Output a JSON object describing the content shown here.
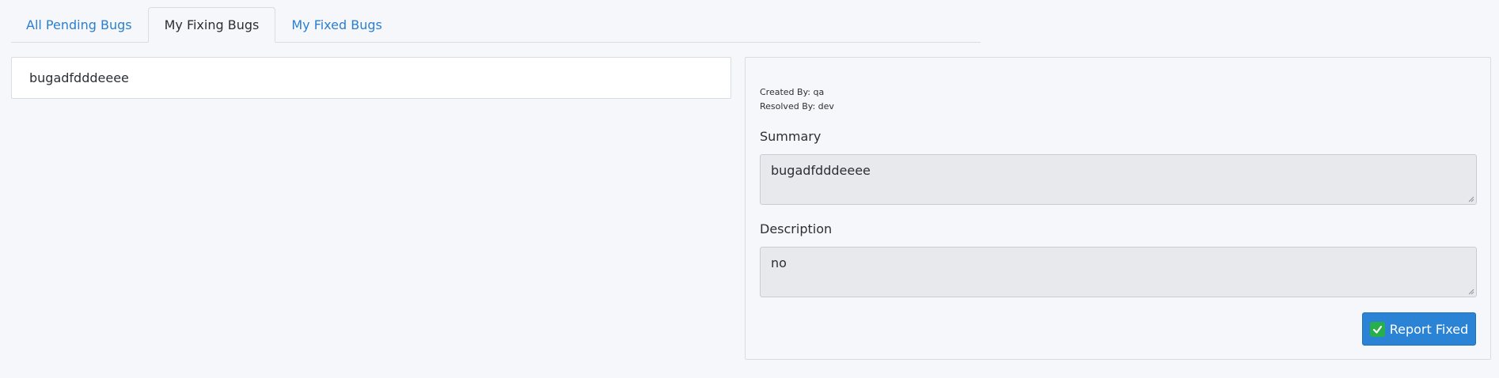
{
  "tabs": [
    {
      "label": "All Pending Bugs",
      "active": false
    },
    {
      "label": "My Fixing Bugs",
      "active": true
    },
    {
      "label": "My Fixed Bugs",
      "active": false
    }
  ],
  "bug_list": {
    "items": [
      {
        "title": "bugadfdddeeee"
      }
    ]
  },
  "detail": {
    "created_by": "Created By: qa",
    "resolved_by": "Resolved By: dev",
    "summary_label": "Summary",
    "summary_value": "bugadfdddeeee",
    "description_label": "Description",
    "description_value": "no",
    "report_button_label": "Report Fixed",
    "report_button_icon": "check-mark-icon"
  },
  "colors": {
    "accent": "#2b83d6",
    "tab_link": "#2a7fd0",
    "check_green": "#27b04a",
    "field_background": "#e7e9ed"
  }
}
